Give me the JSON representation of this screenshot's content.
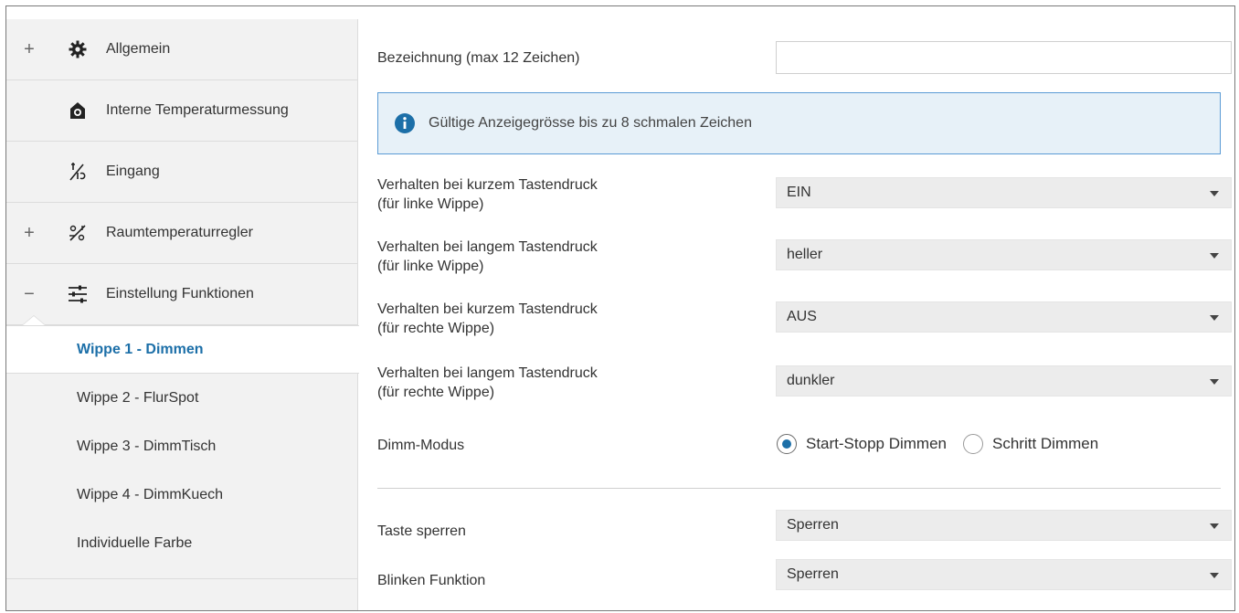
{
  "sidebar": {
    "items": [
      {
        "expander": "+",
        "icon": "gear-icon",
        "label": "Allgemein"
      },
      {
        "expander": "",
        "icon": "thermometer-house-icon",
        "label": "Interne Temperaturmessung"
      },
      {
        "expander": "",
        "icon": "input-icon",
        "label": "Eingang"
      },
      {
        "expander": "+",
        "icon": "room-temperature-icon",
        "label": "Raumtemperaturregler"
      },
      {
        "expander": "−",
        "icon": "sliders-icon",
        "label": "Einstellung Funktionen"
      }
    ],
    "sub_items": [
      {
        "label": "Wippe 1 - Dimmen",
        "active": true
      },
      {
        "label": "Wippe 2 - FlurSpot"
      },
      {
        "label": "Wippe 3 - DimmTisch"
      },
      {
        "label": "Wippe 4 - DimmKuech"
      },
      {
        "label": "Individuelle Farbe"
      }
    ]
  },
  "main": {
    "name_label": "Bezeichnung (max 12 Zeichen)",
    "name_value": "",
    "info_text": "Gültige Anzeigegrösse bis zu 8 schmalen Zeichen",
    "rows": [
      {
        "label_line1": "Verhalten bei kurzem Tastendruck",
        "label_line2": "(für linke Wippe)",
        "value": "EIN"
      },
      {
        "label_line1": "Verhalten bei langem Tastendruck",
        "label_line2": "(für linke Wippe)",
        "value": "heller"
      },
      {
        "label_line1": "Verhalten bei kurzem Tastendruck",
        "label_line2": "(für rechte Wippe)",
        "value": "AUS"
      },
      {
        "label_line1": "Verhalten bei langem Tastendruck",
        "label_line2": "(für rechte Wippe)",
        "value": "dunkler"
      }
    ],
    "dimm_mode": {
      "label": "Dimm-Modus",
      "options": [
        "Start-Stopp Dimmen",
        "Schritt Dimmen"
      ],
      "selected": "Start-Stopp Dimmen"
    },
    "lock_key": {
      "label": "Taste sperren",
      "value": "Sperren"
    },
    "blink": {
      "label": "Blinken Funktion",
      "value": "Sperren"
    }
  },
  "colors": {
    "accent": "#1c6fa8",
    "info_bg": "#e7f1f8",
    "info_border": "#5b9bd5",
    "sidebar_bg": "#f2f2f2"
  }
}
